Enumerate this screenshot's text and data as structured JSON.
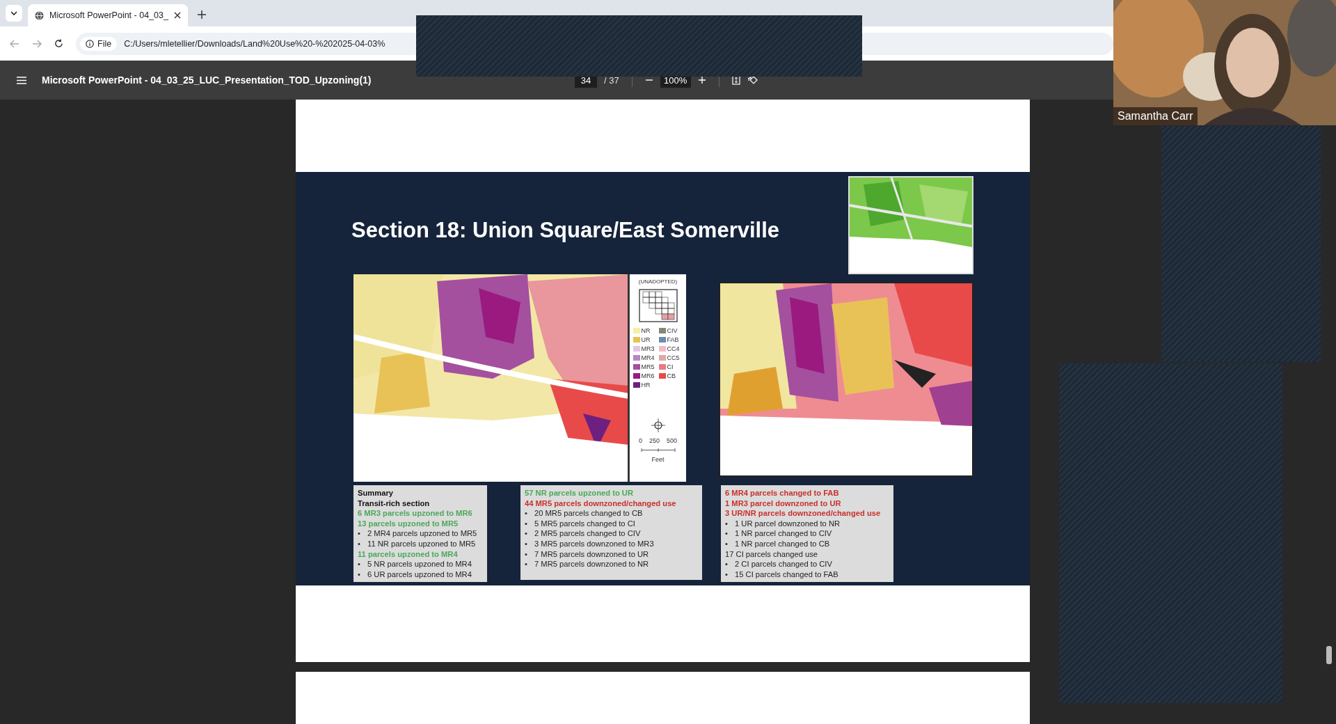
{
  "browser": {
    "tab": {
      "title": "Microsoft PowerPoint - 04_03_",
      "selected": true
    },
    "address": {
      "chip": "File",
      "url": "C:/Users/mletellier/Downloads/Land%20Use%20-%202025-04-03%"
    }
  },
  "pdf_toolbar": {
    "title": "Microsoft PowerPoint - 04_03_25_LUC_Presentation_TOD_Upzoning(1)",
    "page": "34",
    "page_total": "/ 37",
    "zoom": "100%"
  },
  "slide": {
    "title": "Section 18: Union Square/East Somerville",
    "legend": {
      "heading": "(UNADOPTED)",
      "items": [
        {
          "label": "NR",
          "color": "#f7efa0"
        },
        {
          "label": "UR",
          "color": "#e8c256"
        },
        {
          "label": "MR3",
          "color": "#e2c6e2"
        },
        {
          "label": "MR4",
          "color": "#b886c4"
        },
        {
          "label": "MR5",
          "color": "#a4509e"
        },
        {
          "label": "MR6",
          "color": "#9a1a80"
        },
        {
          "label": "HR",
          "color": "#6e2080"
        },
        {
          "label": "CIV",
          "color": "#808a74"
        },
        {
          "label": "FAB",
          "color": "#6a8cb0"
        },
        {
          "label": "CC4",
          "color": "#f2bcc4"
        },
        {
          "label": "CC5",
          "color": "#e2a6ac"
        },
        {
          "label": "CI",
          "color": "#ea7a82"
        },
        {
          "label": "CB",
          "color": "#e84a4a"
        }
      ],
      "scale": [
        "0",
        "250",
        "500"
      ],
      "scale_unit": "Feet"
    },
    "boxes": [
      {
        "lines": [
          {
            "kind": "bold",
            "text": "Summary"
          },
          {
            "kind": "bold",
            "text": "Transit-rich section"
          },
          {
            "kind": "gain",
            "text": "6 MR3 parcels upzoned to MR6"
          },
          {
            "kind": "gain",
            "text": "13 parcels upzoned to MR5"
          },
          {
            "kind": "bullet",
            "marker": "•",
            "text": "2 MR4 parcels upzoned to MR5"
          },
          {
            "kind": "bullet",
            "marker": "•",
            "text": "11 NR parcels upzoned to MR5"
          },
          {
            "kind": "gain",
            "text": "11 parcels upzoned to MR4"
          },
          {
            "kind": "bullet",
            "marker": "•",
            "text": "5 NR parcels upzoned to MR4"
          },
          {
            "kind": "bullet",
            "marker": "•",
            "text": "6 UR parcels upzoned to MR4"
          }
        ]
      },
      {
        "lines": [
          {
            "kind": "gain",
            "text": "57 NR parcels upzoned to UR"
          },
          {
            "kind": "loss",
            "text": "44 MR5 parcels downzoned/changed use"
          },
          {
            "kind": "bullet",
            "marker": "•",
            "text": "20 MR5 parcels changed to CB"
          },
          {
            "kind": "bullet",
            "marker": "•",
            "text": "5 MR5 parcels changed to CI"
          },
          {
            "kind": "bullet",
            "marker": "•",
            "text": "2 MR5 parcels changed to CIV"
          },
          {
            "kind": "bullet",
            "marker": "•",
            "text": "3 MR5 parcels downzoned to MR3"
          },
          {
            "kind": "bullet",
            "marker": "•",
            "text": "7 MR5 parcels downzoned to UR"
          },
          {
            "kind": "bullet",
            "marker": "•",
            "text": "7 MR5 parcels downzoned to NR"
          }
        ]
      },
      {
        "lines": [
          {
            "kind": "loss",
            "text": "6 MR4 parcels changed to FAB"
          },
          {
            "kind": "loss",
            "text": "1 MR3 parcel downzoned to UR"
          },
          {
            "kind": "loss",
            "text": "3 UR/NR parcels downzoned/changed use"
          },
          {
            "kind": "bullet",
            "marker": "•",
            "text": "1 UR parcel downzoned to NR"
          },
          {
            "kind": "bullet",
            "marker": "•",
            "text": "1 NR parcel changed to CIV"
          },
          {
            "kind": "bullet",
            "marker": "•",
            "text": "1 NR parcel changed to CB"
          },
          {
            "kind": "plain",
            "text": "17 CI parcels changed use"
          },
          {
            "kind": "bullet",
            "marker": "•",
            "text": "2 CI parcels changed to CIV"
          },
          {
            "kind": "bullet",
            "marker": "•",
            "text": "15 CI parcels changed to FAB"
          }
        ]
      }
    ]
  },
  "participant": {
    "name": "Samantha Carr"
  }
}
